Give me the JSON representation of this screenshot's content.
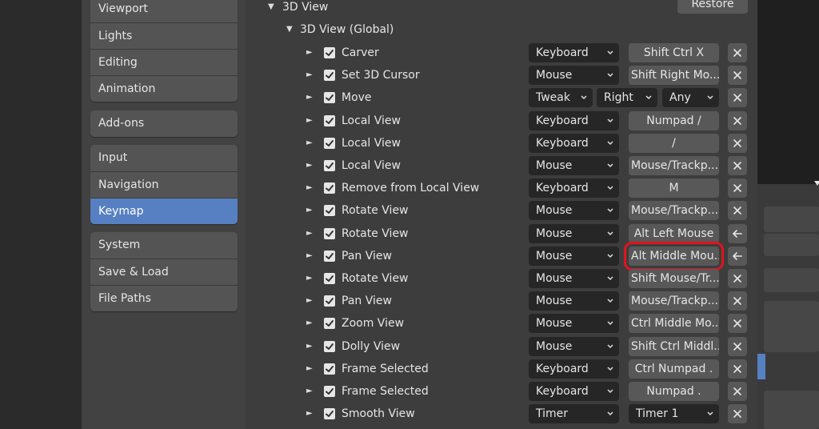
{
  "sidebar": {
    "group1": [
      "Viewport",
      "Lights",
      "Editing",
      "Animation"
    ],
    "group2": [
      "Add-ons"
    ],
    "group3": [
      "Input",
      "Navigation",
      "Keymap"
    ],
    "group4": [
      "System",
      "Save & Load",
      "File Paths"
    ],
    "active": "Keymap"
  },
  "header": {
    "section_title": "3D View",
    "restore_label": "Restore",
    "subsection_title": "3D View (Global)"
  },
  "keymap_items": [
    {
      "name": "Carver",
      "type": "Keyboard",
      "key": "Shift Ctrl X",
      "action": "remove"
    },
    {
      "name": "Set 3D Cursor",
      "type": "Mouse",
      "key": "Shift Right Mo...",
      "action": "remove"
    },
    {
      "name": "Move",
      "type": "Tweak",
      "dir": "Right",
      "mod": "Any",
      "action": "remove"
    },
    {
      "name": "Local View",
      "type": "Keyboard",
      "key": "Numpad /",
      "action": "remove"
    },
    {
      "name": "Local View",
      "type": "Keyboard",
      "key": "/",
      "action": "remove"
    },
    {
      "name": "Local View",
      "type": "Mouse",
      "key": "Mouse/Trackp...",
      "action": "remove"
    },
    {
      "name": "Remove from Local View",
      "type": "Keyboard",
      "key": "M",
      "action": "remove"
    },
    {
      "name": "Rotate View",
      "type": "Mouse",
      "key": "Mouse/Trackp...",
      "action": "remove"
    },
    {
      "name": "Rotate View",
      "type": "Mouse",
      "key": "Alt Left Mouse",
      "action": "restore"
    },
    {
      "name": "Pan View",
      "type": "Mouse",
      "key": "Alt Middle Mou...",
      "action": "restore",
      "highlight": true
    },
    {
      "name": "Rotate View",
      "type": "Mouse",
      "key": "Shift Mouse/Tr...",
      "action": "remove"
    },
    {
      "name": "Pan View",
      "type": "Mouse",
      "key": "Mouse/Trackp...",
      "action": "remove"
    },
    {
      "name": "Zoom View",
      "type": "Mouse",
      "key": "Ctrl Middle Mo...",
      "action": "remove"
    },
    {
      "name": "Dolly View",
      "type": "Mouse",
      "key": "Shift Ctrl Middl...",
      "action": "remove"
    },
    {
      "name": "Frame Selected",
      "type": "Keyboard",
      "key": "Ctrl Numpad .",
      "action": "remove"
    },
    {
      "name": "Frame Selected",
      "type": "Keyboard",
      "key": "Numpad .",
      "action": "remove"
    },
    {
      "name": "Smooth View",
      "type": "Timer",
      "timer": "Timer 1",
      "action": "remove"
    }
  ],
  "colors": {
    "accent": "#5680c2",
    "highlight_box": "#e0141e",
    "panel_bg": "#3d3d3d",
    "sidebar_bg": "#424242"
  }
}
